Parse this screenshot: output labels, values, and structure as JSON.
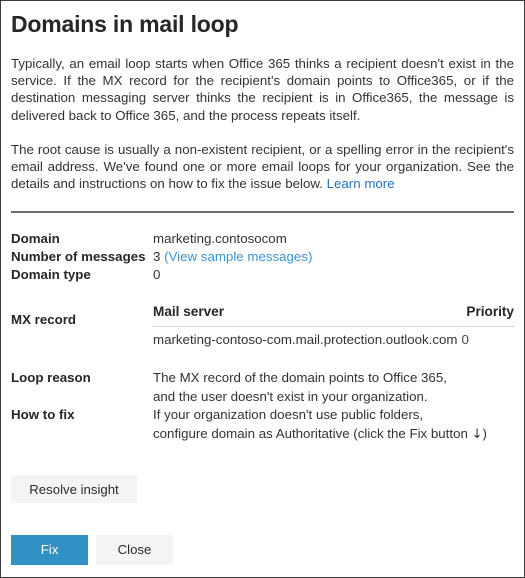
{
  "panel": {
    "title": "Domains in mail loop",
    "intro": {
      "paragraph_1": "Typically, an email loop starts when Office 365 thinks a recipient doesn't exist in the service. If the MX record for the recipient's domain points to Office365, or if the destination messaging server thinks the recipient is in Office365, the message is delivered back to Office 365, and the process repeats itself.",
      "paragraph_2_text": "The root cause is usually a non-existent recipient, or a spelling error in the recipient's email address. We've found one or more email loops for your organization. See the details and instructions on how to fix the issue below.",
      "learn_more_label": "Learn more"
    },
    "details": {
      "domain_label": "Domain",
      "domain_value": "marketing.contosocom",
      "messages_label": "Number of messages",
      "messages_count": "3",
      "messages_link_label": "(View sample messages)",
      "domain_type_label": "Domain type",
      "domain_type_value": "0"
    },
    "mx_record": {
      "label": "MX record",
      "col_mail_server": "Mail server",
      "col_priority": "Priority",
      "server_value": "marketing-contoso-com.mail.protection.outlook.com",
      "priority_value": "0"
    },
    "loop_reason": {
      "label": "Loop reason",
      "line_1": "The MX record of the domain points to Office 365,",
      "line_2": "and the user doesn't exist in your organization."
    },
    "how_to_fix": {
      "label": "How to fix",
      "line_1": "If your organization doesn't use public folders,",
      "line_2_before_arrow": "configure domain as Authoritative (click the Fix button ",
      "arrow_glyph": "↓",
      "line_2_after_arrow": ")"
    },
    "actions": {
      "resolve_insight_label": "Resolve insight",
      "fix_label": "Fix",
      "close_label": "Close"
    },
    "colors": {
      "accent_blue": "#3190c4",
      "link_blue": "#2072c4",
      "link_soft_blue": "#3c93d4",
      "button_gray": "#f4f4f4",
      "divider_gray": "#6e6e6e",
      "text_dark": "#262626"
    }
  }
}
